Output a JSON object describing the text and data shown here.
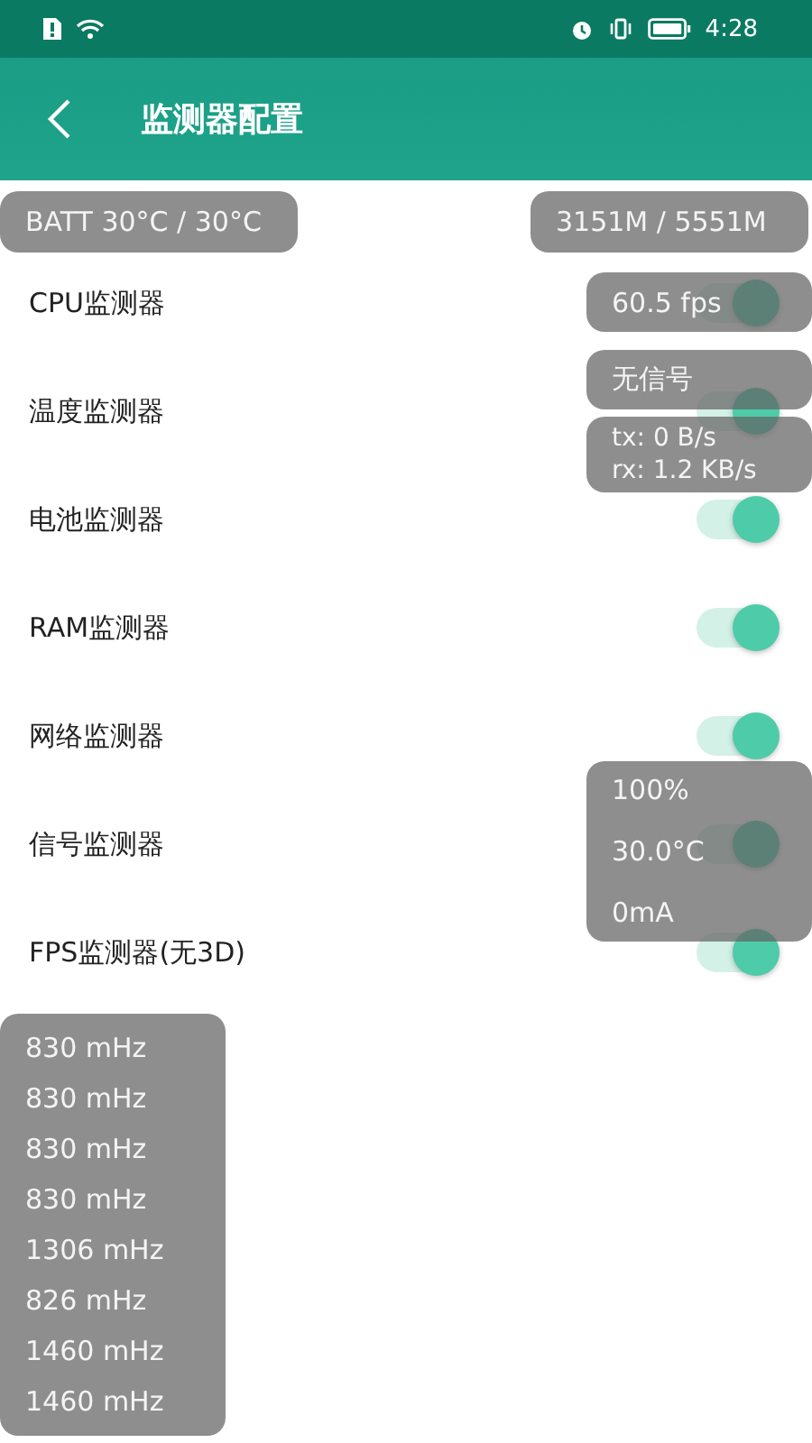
{
  "status_bar": {
    "time": "4:28"
  },
  "app_bar": {
    "title": "监测器配置"
  },
  "settings": [
    {
      "label": "CPU监测器",
      "on": true
    },
    {
      "label": "温度监测器",
      "on": true
    },
    {
      "label": "电池监测器",
      "on": true
    },
    {
      "label": "RAM监测器",
      "on": true
    },
    {
      "label": "网络监测器",
      "on": true
    },
    {
      "label": "信号监测器",
      "on": true
    },
    {
      "label": "FPS监测器(无3D)",
      "on": true
    }
  ],
  "overlays": {
    "battery_temp": "BATT 30°C / 30°C",
    "memory": "3151M / 5551M",
    "fps": "60.5 fps",
    "signal": "无信号",
    "network": [
      "tx: 0 B/s",
      "rx: 1.2 KB/s"
    ],
    "battery": [
      "100%",
      "30.0°C",
      "0mA"
    ],
    "cpu_freqs": [
      "830 mHz",
      "830 mHz",
      "830 mHz",
      "830 mHz",
      "1306 mHz",
      "826 mHz",
      "1460 mHz",
      "1460 mHz"
    ]
  }
}
